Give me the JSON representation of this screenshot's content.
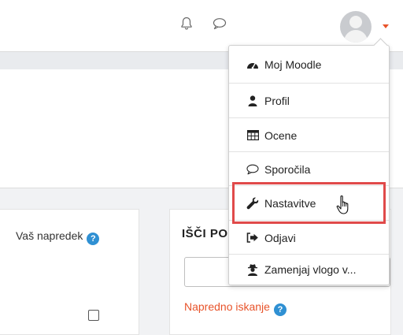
{
  "topbar": {
    "icons": [
      "bell-icon",
      "speech-bubble-icon",
      "user-avatar",
      "caret-down-icon"
    ],
    "caret_color": "#e8532a"
  },
  "progress_card": {
    "title": "Vaš napredek",
    "help_icon": "question-circle-icon",
    "checkbox_checked": false
  },
  "search_card": {
    "heading": "IŠČI PO",
    "search_value": "",
    "advanced_link": "Napredno iskanje",
    "link_color": "#e8532a"
  },
  "user_menu": {
    "items": [
      {
        "icon": "tachometer-icon",
        "label": "Moj Moodle"
      },
      {
        "icon": "user-icon",
        "label": "Profil"
      },
      {
        "icon": "table-icon",
        "label": "Ocene"
      },
      {
        "icon": "comment-icon",
        "label": "Sporočila"
      },
      {
        "icon": "wrench-icon",
        "label": "Nastavitve",
        "highlighted": true
      },
      {
        "icon": "sign-out-icon",
        "label": "Odjavi"
      },
      {
        "icon": "user-secret-icon",
        "label": "Zamenjaj vlogo v..."
      }
    ],
    "highlight_color": "#e04a4a"
  }
}
